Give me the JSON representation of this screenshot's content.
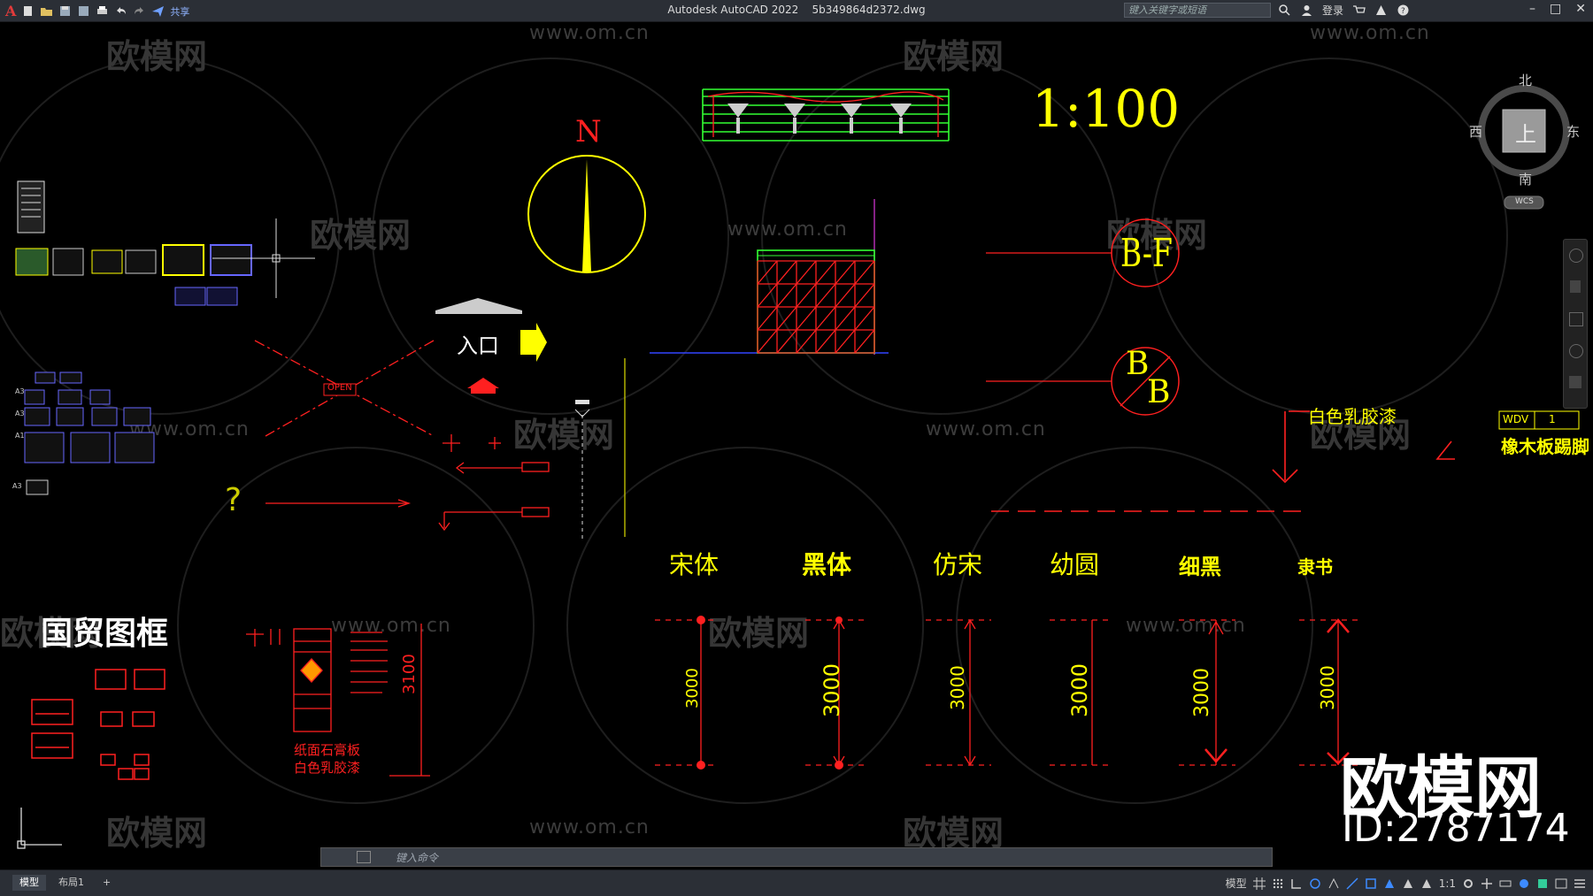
{
  "window": {
    "app_title": "Autodesk AutoCAD 2022",
    "file_name": "5b349864d2372.dwg",
    "share_label": "共享",
    "search_placeholder": "键入关键字或短语",
    "login_label": "登录"
  },
  "viewcube": {
    "north": "北",
    "south": "南",
    "east": "东",
    "west": "西",
    "face": "上",
    "wcs": "WCS"
  },
  "drawing": {
    "scale": "1:100",
    "north_letter": "N",
    "entrance": "入口",
    "open_tag": "OPEN",
    "question": "?",
    "frame_title": "国贸图框",
    "tag_bf": "B-F",
    "tag_b_top": "B",
    "tag_b_bottom": "B",
    "paint_label": "白色乳胶漆",
    "wdv_label": "WDV",
    "wdv_number": "1",
    "skirting_label": "橡木板踢脚",
    "gypsum_label": "纸面石膏板",
    "gypsum_paint_label": "白色乳胶漆",
    "dim_3100": "3100",
    "sheet_labels": [
      "A3",
      "A3",
      "A1",
      "A3"
    ],
    "font_samples": [
      "宋体",
      "黑体",
      "仿宋",
      "幼圆",
      "细黑",
      "隶书"
    ],
    "dim_values": [
      "3000",
      "3000",
      "3000",
      "3000",
      "3000",
      "3000"
    ],
    "watermark_url": "www.om.cn",
    "watermark_brand": "欧模网",
    "brand_big": "欧模网",
    "brand_id": "ID:2787174"
  },
  "command": {
    "placeholder": "键入命令"
  },
  "status": {
    "tabs": [
      "模型",
      "布局1"
    ],
    "add_tab": "+",
    "model_label": "模型",
    "scale_label": "1:1"
  },
  "colors": {
    "yellow": "#ffff00",
    "red": "#ff2020",
    "green": "#33ff33",
    "background": "#000000"
  }
}
